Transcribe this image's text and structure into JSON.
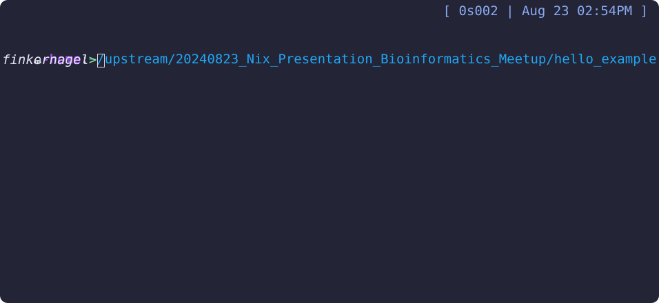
{
  "status": {
    "text": "[ 0s002 | Aug 23 02:54PM ]"
  },
  "prompt": {
    "ellipsis": "…",
    "context": "-home",
    "separator": ":",
    "cwd": "~/upstream/20240823_Nix_Presentation_Bioinformatics_Meetup/hello_example",
    "user": "finkernagel",
    "caret": ">"
  },
  "colors": {
    "background": "#232435",
    "status": "#8aaaf3",
    "context": "#a248f2",
    "cwd": "#21a6f4",
    "caret": "#a7dd7c"
  }
}
